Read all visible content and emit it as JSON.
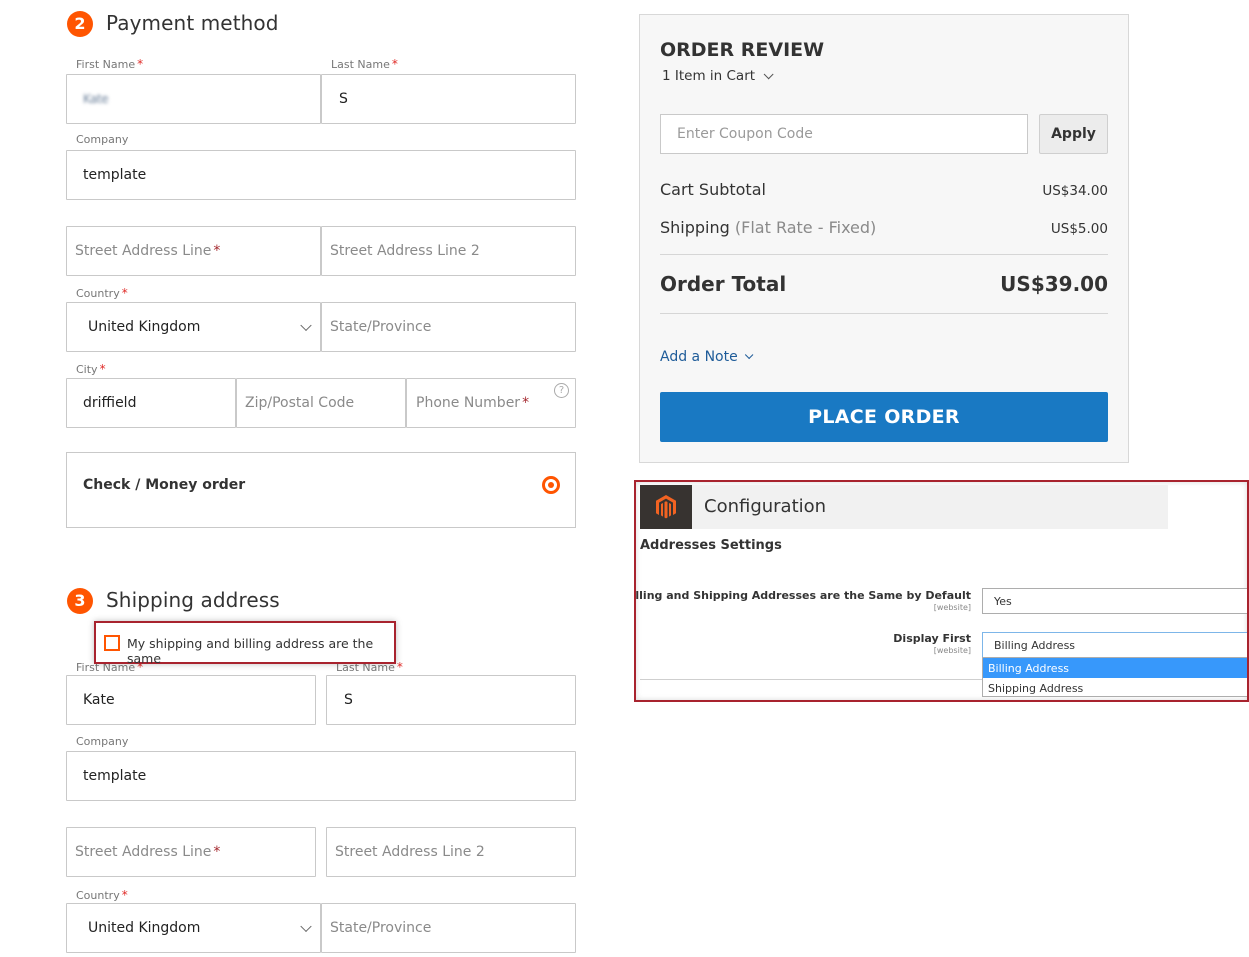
{
  "payment_section": {
    "step_number": "2",
    "title": "Payment method",
    "fields": {
      "first_name": {
        "label": "First Name",
        "value": "Kate",
        "blurred": true
      },
      "last_name": {
        "label": "Last Name",
        "value": "S"
      },
      "company": {
        "label": "Company",
        "value": "template"
      },
      "street_line_1": {
        "placeholder": "Street Address Line"
      },
      "street_line_2": {
        "placeholder": "Street Address Line 2"
      },
      "country": {
        "label": "Country",
        "value": "United Kingdom"
      },
      "state": {
        "placeholder": "State/Province"
      },
      "city": {
        "label": "City",
        "value": "driffield"
      },
      "zip": {
        "placeholder": "Zip/Postal Code"
      },
      "phone": {
        "placeholder": "Phone Number"
      }
    },
    "required_mark": "*",
    "help_icon": "?",
    "method": {
      "label": "Check / Money order",
      "selected": true
    }
  },
  "shipping_section": {
    "step_number": "3",
    "title": "Shipping address",
    "same_address_checkbox": {
      "label": "My shipping and billing address are the same",
      "checked": false
    },
    "fields": {
      "first_name": {
        "label": "First Name",
        "value": "Kate"
      },
      "last_name": {
        "label": "Last Name",
        "value": "S"
      },
      "company": {
        "label": "Company",
        "value": "template"
      },
      "street_line_1": {
        "placeholder": "Street Address Line"
      },
      "street_line_2": {
        "placeholder": "Street Address Line 2"
      },
      "country": {
        "label": "Country",
        "value": "United Kingdom"
      },
      "state": {
        "placeholder": "State/Province"
      }
    }
  },
  "order_review": {
    "title": "ORDER REVIEW",
    "cart_count": "1 Item in Cart",
    "coupon_placeholder": "Enter Coupon Code",
    "apply_label": "Apply",
    "subtotal_label": "Cart Subtotal",
    "subtotal_value": "US$34.00",
    "shipping_label": "Shipping",
    "shipping_method": "(Flat Rate - Fixed)",
    "shipping_value": "US$5.00",
    "total_label": "Order Total",
    "total_value": "US$39.00",
    "add_note_label": "Add a Note",
    "place_order_label": "PLACE ORDER"
  },
  "config_panel": {
    "title": "Configuration",
    "section_title": "Addresses Settings",
    "rows": [
      {
        "label": "Billing and Shipping Addresses are the Same by Default",
        "scope": "[website]",
        "value": "Yes"
      },
      {
        "label": "Display First",
        "scope": "[website]",
        "value": "Billing Address"
      }
    ],
    "dropdown_options": [
      {
        "label": "Billing Address",
        "selected": true
      },
      {
        "label": "Shipping Address",
        "selected": false
      }
    ]
  },
  "colors": {
    "accent_orange": "#ff5501",
    "primary_blue": "#1979c3",
    "highlight_red": "#a8232e",
    "link_blue": "#1f5c99",
    "dropdown_selected": "#3798fb"
  }
}
